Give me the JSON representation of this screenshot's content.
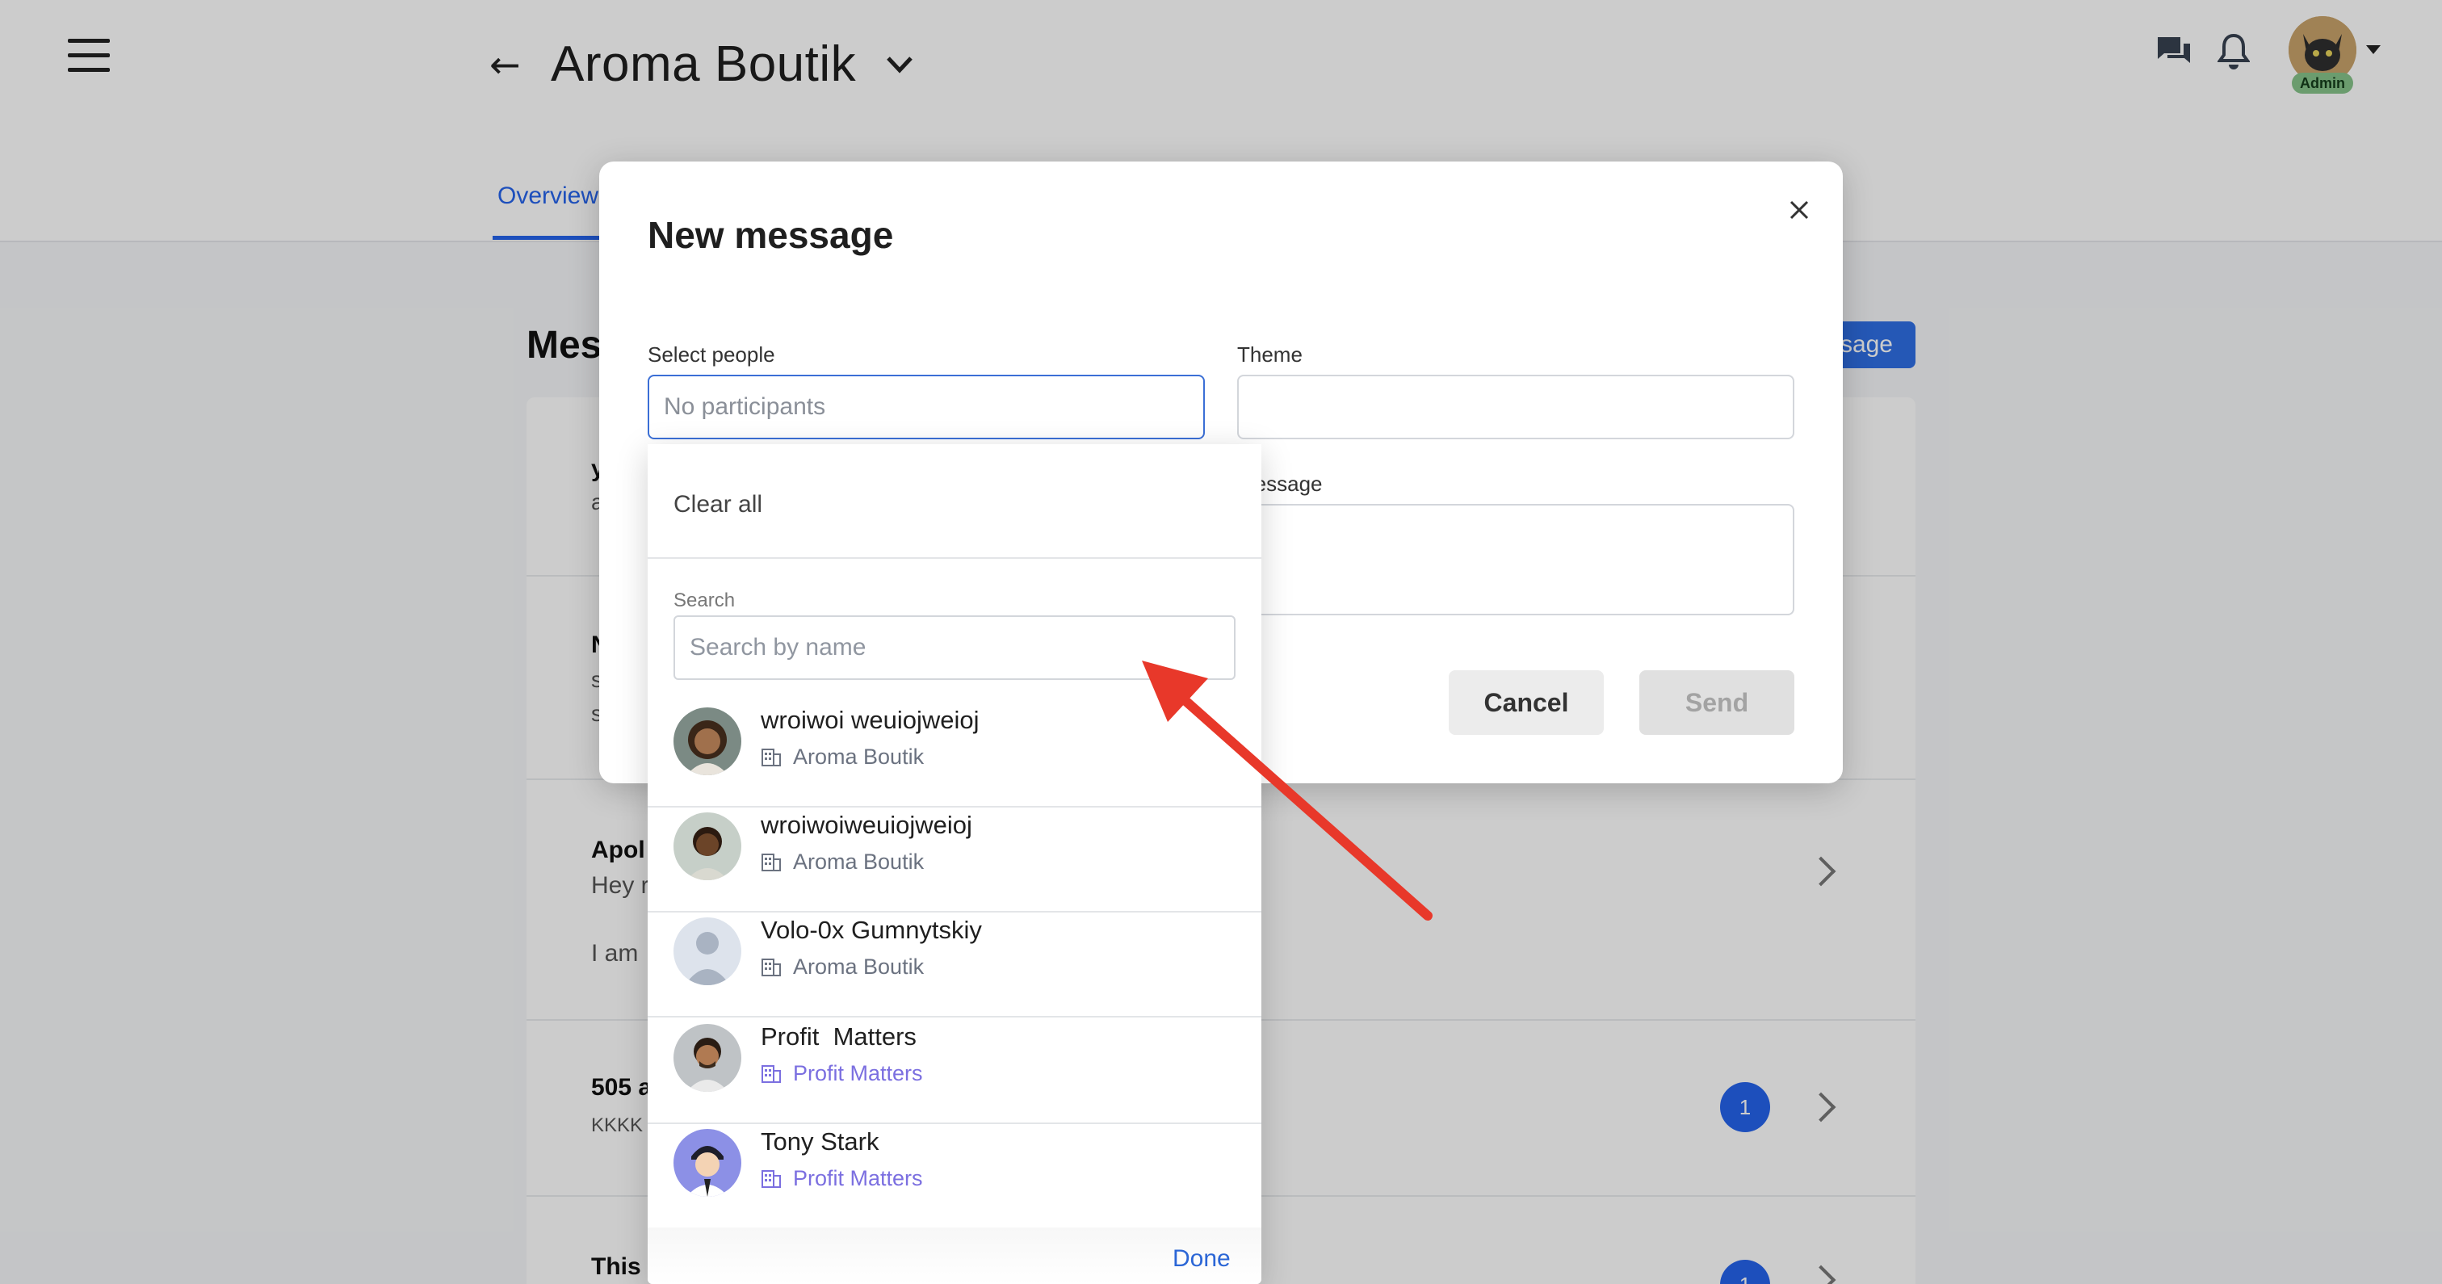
{
  "header": {
    "title": "Aroma Boutik",
    "user_badge": "Admin"
  },
  "tabs": [
    {
      "label": "Overview"
    }
  ],
  "messages_page": {
    "title_partial": "Mes",
    "new_message_partial": "sage",
    "rows": [
      {
        "title": "y",
        "sub": "a"
      },
      {
        "title": "N",
        "sub": "s",
        "sub2": "s"
      },
      {
        "title": "Apol",
        "sub": "Hey r",
        "sub2": "I am"
      },
      {
        "title": "505 a",
        "sub": "KKKK",
        "badge": "1"
      },
      {
        "title": "This",
        "badge": "1"
      }
    ]
  },
  "modal": {
    "title": "New message",
    "select_people_label": "Select people",
    "select_people_placeholder": "No participants",
    "theme_label": "Theme",
    "message_label": "Message",
    "cancel_label": "Cancel",
    "send_label": "Send"
  },
  "dropdown": {
    "clear_all": "Clear all",
    "search_label": "Search",
    "search_placeholder": "Search by name",
    "done_label": "Done",
    "people": [
      {
        "name": "wroiwoi weuiojweioj",
        "org": "Aroma Boutik",
        "org_color": "#6b7280"
      },
      {
        "name": "wroiwoiweuiojweioj",
        "org": "Aroma Boutik",
        "org_color": "#6b7280"
      },
      {
        "name": "Volo-0x Gumnytskiy",
        "org": "Aroma Boutik",
        "org_color": "#6b7280"
      },
      {
        "name": "Profit  Matters",
        "org": "Profit Matters",
        "org_color": "#7b6fe0"
      },
      {
        "name": "Tony Stark",
        "org": "Profit Matters",
        "org_color": "#7b6fe0"
      }
    ]
  },
  "colors": {
    "accent": "#2563eb",
    "annotation_arrow": "#e8382a"
  }
}
